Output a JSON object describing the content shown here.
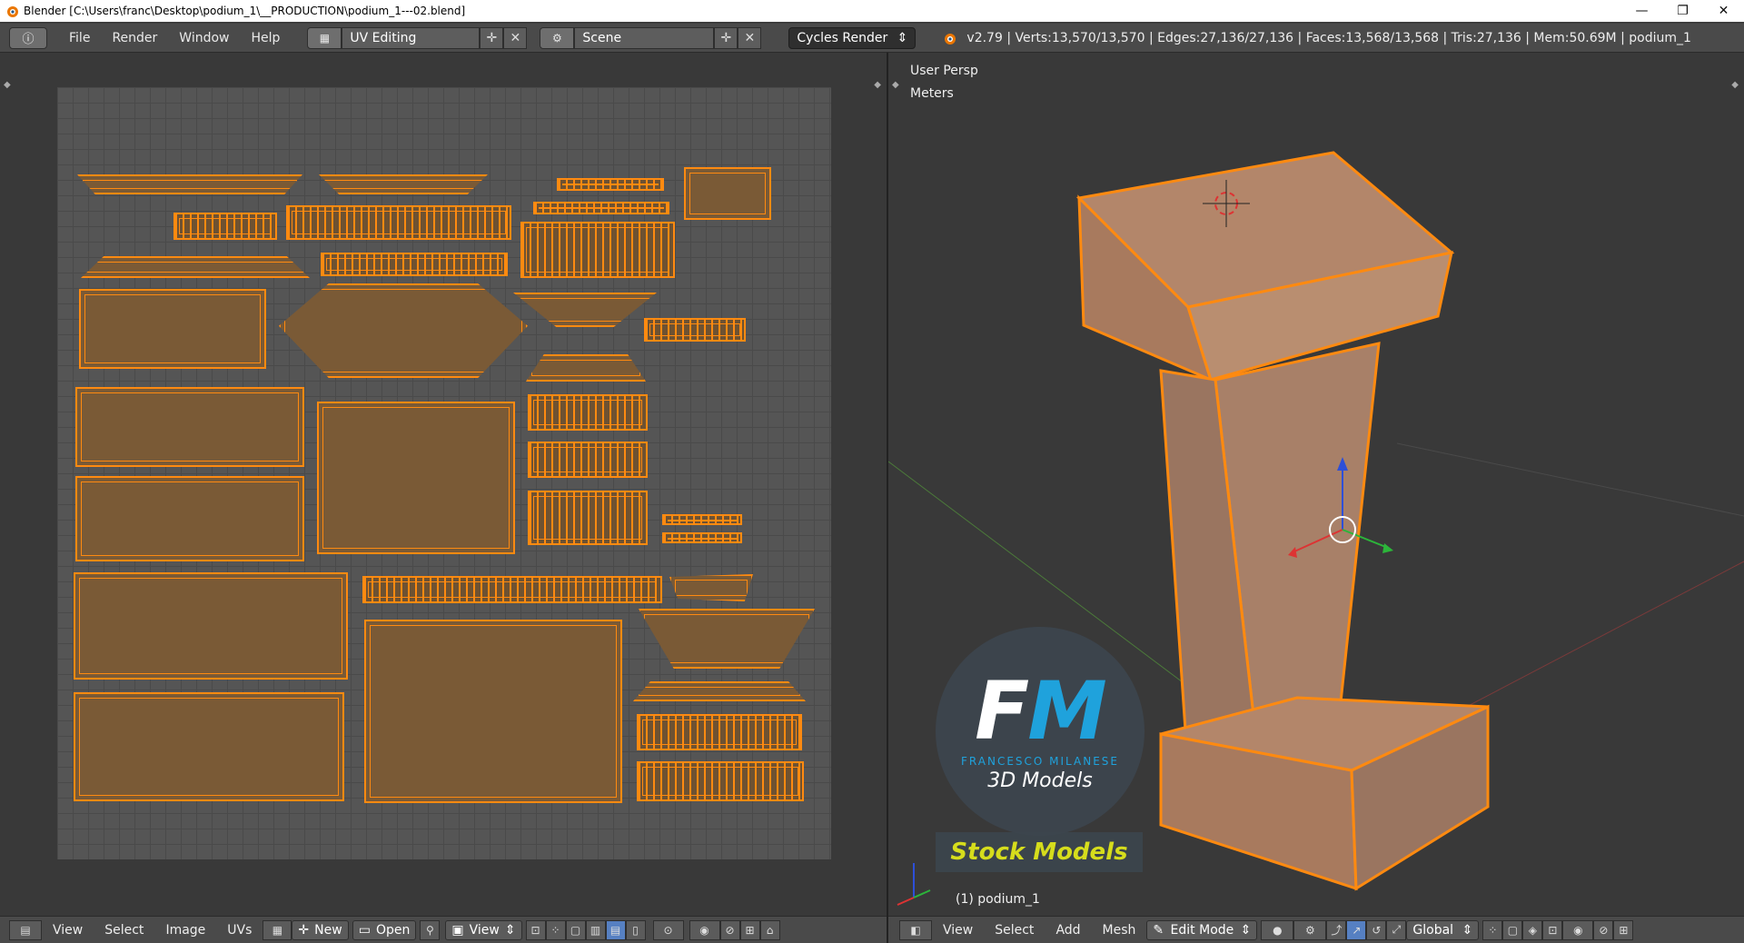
{
  "window": {
    "title": "Blender [C:\\Users\\franc\\Desktop\\podium_1\\__PRODUCTION\\podium_1---02.blend]",
    "minimize": "—",
    "maximize": "❐",
    "close": "✕"
  },
  "info_header": {
    "menus": [
      "File",
      "Render",
      "Window",
      "Help"
    ],
    "layout_name": "UV Editing",
    "scene_name": "Scene",
    "render_engine": "Cycles Render",
    "stats": "v2.79 | Verts:13,570/13,570 | Edges:27,136/27,136 | Faces:13,568/13,568 | Tris:27,136 | Mem:50.69M | podium_1"
  },
  "uv_editor": {
    "menus": [
      "View",
      "Select",
      "Image",
      "UVs"
    ],
    "new_label": "New",
    "open_label": "Open",
    "view_label": "View"
  },
  "viewport": {
    "view_label": "User Persp",
    "units_label": "Meters",
    "object_label": "(1) podium_1",
    "menus": [
      "View",
      "Select",
      "Add",
      "Mesh"
    ],
    "mode": "Edit Mode",
    "orientation": "Global"
  },
  "watermark": {
    "fm_f": "F",
    "fm_m": "M",
    "name": "FRANCESCO MILANESE",
    "sub": "3D Models",
    "stock": "Stock Models"
  },
  "colors": {
    "accent_orange": "#ff8a10",
    "brand_blue": "#1fa2dc",
    "stock_yellow": "#d6dd1c"
  }
}
